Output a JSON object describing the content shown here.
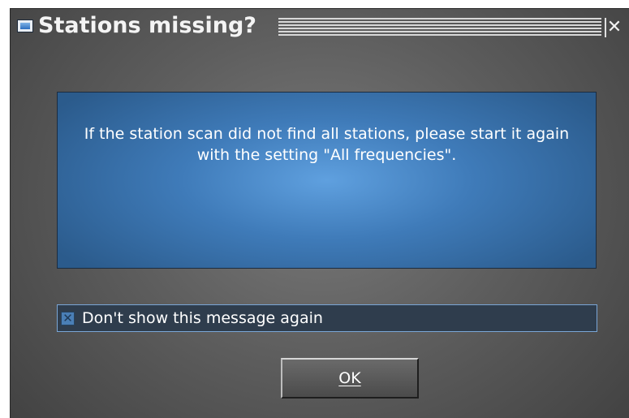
{
  "window": {
    "title": "Stations missing?",
    "close_symbol": "✕",
    "icon": "window-app-icon"
  },
  "message": {
    "text": "If the station scan did not find all stations, please start it again with the setting \"All frequencies\"."
  },
  "checkbox": {
    "label": "Don't show this message again",
    "checked": true
  },
  "buttons": {
    "ok_label": "OK"
  },
  "colors": {
    "dialog_background": "#5e5e5e",
    "panel_blue": "#3f7bb9",
    "checkbox_border": "#7aa6d6"
  }
}
